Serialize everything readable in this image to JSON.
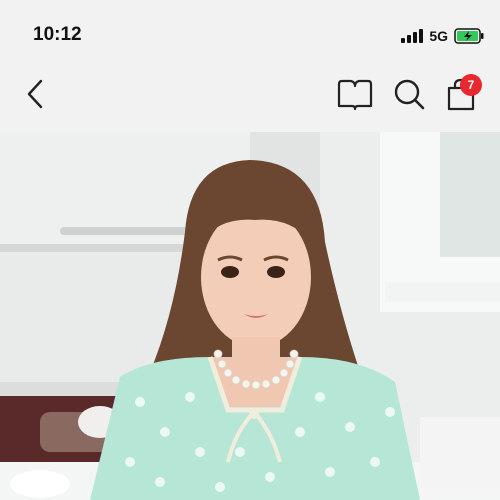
{
  "status_bar": {
    "time": "10:12",
    "network": "5G",
    "battery_icon": "battery-charging-icon",
    "signal_icon": "signal-bars-icon"
  },
  "nav": {
    "back_icon": "chevron-left-icon",
    "book_icon": "book-icon",
    "search_icon": "search-icon",
    "cart_icon": "shopping-bag-icon",
    "cart_count": "7"
  },
  "hero": {
    "image_alt": "product-photo",
    "colors": {
      "dress": "#b6e6d6",
      "hair": "#6b4630",
      "badge": "#e8282e"
    }
  }
}
